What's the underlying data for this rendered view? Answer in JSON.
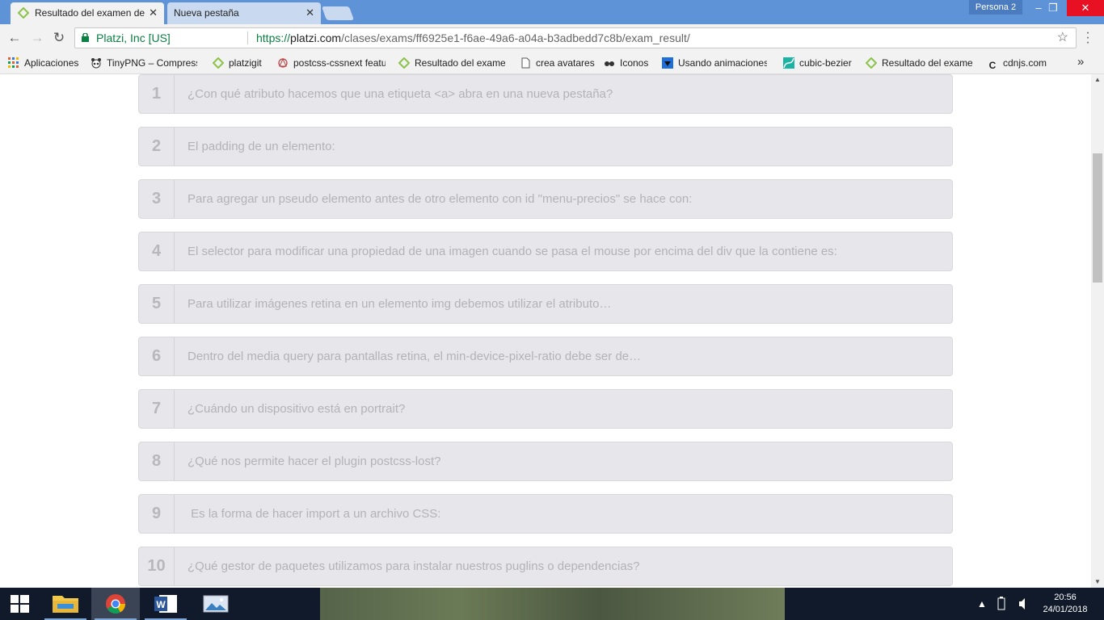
{
  "browser": {
    "tabs": [
      {
        "title": "Resultado del examen de",
        "active": true
      },
      {
        "title": "Nueva pestaña",
        "active": false
      }
    ],
    "profile": "Persona 2",
    "window_controls": {
      "minimize": "–",
      "restore": "❐",
      "close": "✕"
    },
    "address": {
      "org": "Platzi, Inc [US]",
      "scheme": "https://",
      "host": "platzi.com",
      "path": "/clases/exams/ff6925e1-f6ae-49a6-a04a-b3adbedd7c8b/exam_result/"
    },
    "bookmarks": [
      {
        "label": "Aplicaciones",
        "icon": "apps-grid-icon"
      },
      {
        "label": "TinyPNG – Compress",
        "icon": "panda-icon"
      },
      {
        "label": "platzigit",
        "icon": "platzi-icon"
      },
      {
        "label": "postcss-cssnext featu",
        "icon": "postcss-icon"
      },
      {
        "label": "Resultado del exame",
        "icon": "platzi-icon"
      },
      {
        "label": "crea avatares",
        "icon": "page-icon"
      },
      {
        "label": "Iconos",
        "icon": "glasses-icon"
      },
      {
        "label": "Usando animaciones",
        "icon": "animation-icon"
      },
      {
        "label": "cubic-bezier",
        "icon": "bezier-icon"
      },
      {
        "label": "Resultado del exame",
        "icon": "platzi-icon"
      },
      {
        "label": "cdnjs.com",
        "icon": "cdnjs-icon"
      }
    ],
    "bookmarks_more": "»"
  },
  "questions": [
    {
      "num": "1",
      "text": "¿Con qué atributo hacemos que una etiqueta <a> abra en una nueva pestaña?"
    },
    {
      "num": "2",
      "text": "El padding de un elemento:"
    },
    {
      "num": "3",
      "text": "Para agregar un pseudo elemento antes de otro elemento con id \"menu-precios\" se hace con:"
    },
    {
      "num": "4",
      "text": "El selector para modificar una propiedad de una imagen cuando se pasa el mouse por encima del div que la contiene es:"
    },
    {
      "num": "5",
      "text": "Para utilizar imágenes retina en un elemento img debemos utilizar el atributo…"
    },
    {
      "num": "6",
      "text": "Dentro del media query para pantallas retina, el min-device-pixel-ratio debe ser de…"
    },
    {
      "num": "7",
      "text": "¿Cuándo un dispositivo está en portrait?"
    },
    {
      "num": "8",
      "text": "¿Qué nos permite hacer el plugin postcss-lost?"
    },
    {
      "num": "9",
      "text": " Es la forma de hacer import a un archivo CSS:"
    },
    {
      "num": "10",
      "text": "¿Qué gestor de paquetes utilizamos para instalar nuestros puglins o dependencias?"
    }
  ],
  "taskbar": {
    "apps": [
      {
        "name": "file-explorer",
        "icon": "folder-icon"
      },
      {
        "name": "chrome",
        "icon": "chrome-icon",
        "active": true
      },
      {
        "name": "word",
        "icon": "word-icon"
      },
      {
        "name": "photos",
        "icon": "photos-icon"
      }
    ],
    "clock_time": "20:56",
    "clock_date": "24/01/2018"
  },
  "colors": {
    "titlebar": "#5e93d8",
    "question_bg": "#e7e7eb",
    "question_text": "#b3b3b7",
    "secure_green": "#0b8043"
  }
}
